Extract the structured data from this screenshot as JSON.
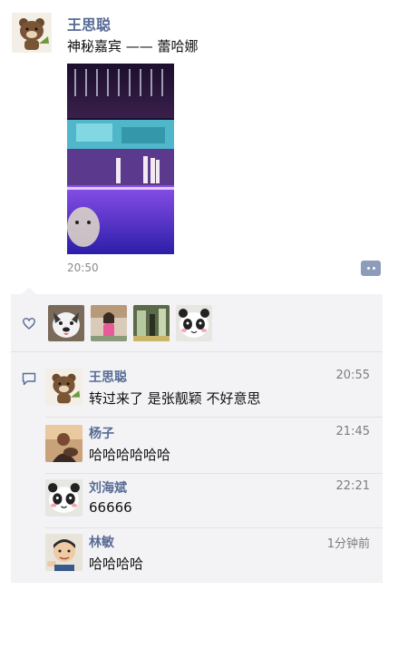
{
  "post": {
    "author": "王思聪",
    "text": "神秘嘉宾 —— 蕾哈娜",
    "time": "20:50"
  },
  "likes": {
    "count": 4,
    "avatars": [
      "dog-avatar",
      "girl-avatar",
      "green-photo-avatar",
      "panda-avatar"
    ]
  },
  "comments": [
    {
      "name": "王思聪",
      "time": "20:55",
      "text": "转过来了 是张靓颖 不好意思"
    },
    {
      "name": "杨子",
      "time": "21:45",
      "text": "哈哈哈哈哈哈"
    },
    {
      "name": "刘海斌",
      "time": "22:21",
      "text": "66666"
    },
    {
      "name": "林敏",
      "time": "1分钟前",
      "text": "哈哈哈哈"
    }
  ],
  "colors": {
    "name_link": "#576b95",
    "panel_bg": "#f3f3f5",
    "action_button": "#8c9cb9"
  }
}
